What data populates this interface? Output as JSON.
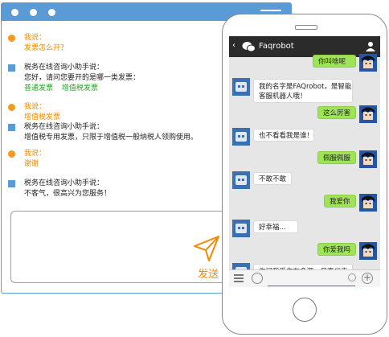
{
  "desktop": {
    "messages": [
      {
        "kind": "user",
        "lines": [
          {
            "text": "我说：",
            "color": "orange"
          },
          {
            "text": "发票怎么开？",
            "color": "orange"
          }
        ]
      },
      {
        "kind": "bot",
        "lines": [
          {
            "text": "税务在线咨询小助手说：",
            "color": "dark"
          },
          {
            "text": "您好，请问您要开的是哪一类发票：",
            "color": "dark"
          },
          {
            "text": "普通发票     增值税发票",
            "color": "green"
          }
        ]
      },
      {
        "kind": "user",
        "lines": [
          {
            "text": "我说：",
            "color": "orange"
          },
          {
            "text": "增值税发票",
            "color": "orange"
          }
        ]
      },
      {
        "kind": "bot",
        "lines": [
          {
            "text": "税务在线咨询小助手说：",
            "color": "dark"
          },
          {
            "text": "增值税专用发票，只限于增值税一般纳税人领购使用。",
            "color": "dark"
          }
        ]
      },
      {
        "kind": "user",
        "lines": [
          {
            "text": "我说：",
            "color": "orange"
          },
          {
            "text": "谢谢",
            "color": "orange"
          }
        ]
      },
      {
        "kind": "bot",
        "lines": [
          {
            "text": "税务在线咨询小助手说：",
            "color": "dark"
          },
          {
            "text": "不客气，很高兴为您服务！",
            "color": "dark"
          }
        ]
      }
    ],
    "send_label": "发送"
  },
  "phone": {
    "title": "Faqrobot",
    "back_label": "‹",
    "chat": [
      {
        "side": "r",
        "text": "你叫啥呢"
      },
      {
        "side": "l",
        "text": "我的名字是FAQrobot，是智能\n客服机器人哦！"
      },
      {
        "side": "r",
        "text": "这么厉害"
      },
      {
        "side": "l",
        "text": "也不看看我是谁！"
      },
      {
        "side": "r",
        "text": "佩服佩服"
      },
      {
        "side": "l",
        "text": "不敢不敢"
      },
      {
        "side": "r",
        "text": "我爱你"
      },
      {
        "side": "l",
        "text": "好幸福..."
      },
      {
        "side": "r",
        "text": "你爱我吗"
      },
      {
        "side": "l",
        "text": "你问我爱你有多深，月亮代表\n我的心！"
      }
    ]
  },
  "colors": {
    "accent": "#5b9bd5",
    "orange": "#f08a00",
    "green": "#2aa02a",
    "bubble_green": "#9fe358"
  },
  "icons": [
    "wechat-icon",
    "person-icon",
    "menu-icon",
    "voice-icon",
    "smile-icon",
    "plus-icon",
    "paper-plane-icon",
    "robot-avatar",
    "user-avatar"
  ]
}
